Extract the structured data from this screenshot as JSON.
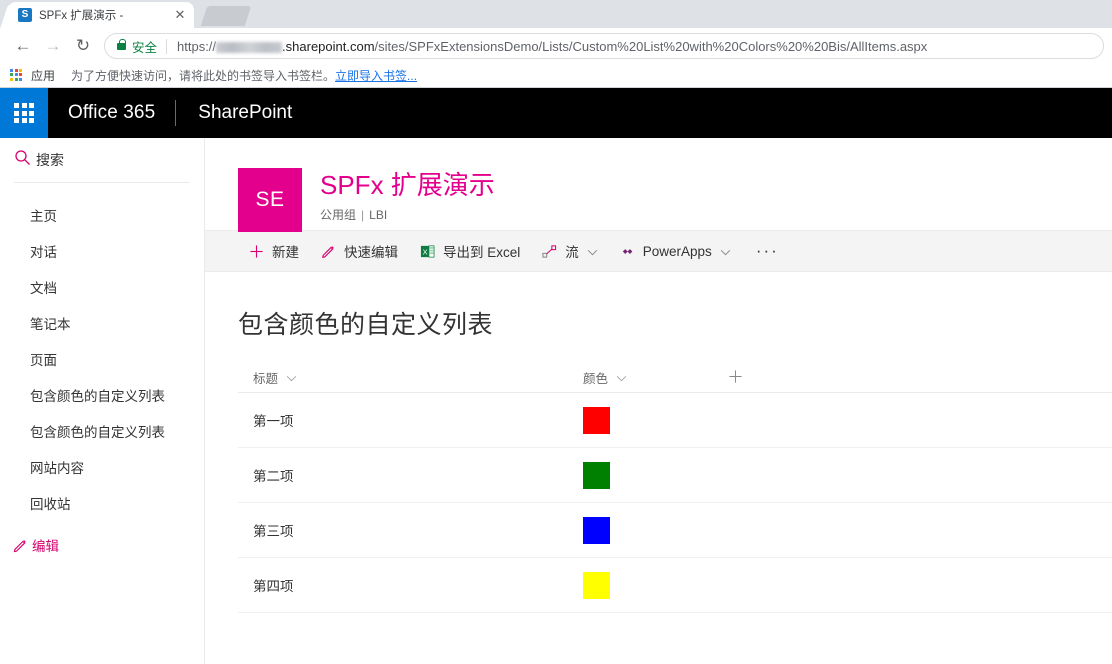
{
  "browser": {
    "tab": {
      "title": "SPFx 扩展演示 -",
      "favicon": "sharepoint-icon",
      "close_icon": "close-icon"
    },
    "new_tab_icon": "new-tab-button",
    "back_icon": "back-arrow-icon",
    "forward_icon": "forward-arrow-icon",
    "reload_icon": "reload-icon",
    "security": {
      "lock_icon": "lock-icon",
      "label": "安全"
    },
    "url": {
      "scheme": "https://",
      "tenant_blurred": "",
      "host_suffix": ".sharepoint.com",
      "path": "/sites/SPFxExtensionsDemo/Lists/Custom%20List%20with%20Colors%20%20Bis/AllItems.aspx",
      "full": "https://.sharepoint.com/sites/SPFxExtensionsDemo/Lists/Custom%20List%20with%20Colors%20%20Bis/AllItems.aspx"
    },
    "bookmarks": {
      "apps_icon": "apps-grid-icon",
      "apps_label": "应用",
      "hint": "为了方便快速访问，请将此处的书签导入书签栏。",
      "import_link": "立即导入书签..."
    }
  },
  "suitebar": {
    "waffle_icon": "waffle-icon",
    "brand": "Office 365",
    "app": "SharePoint"
  },
  "leftnav": {
    "search": {
      "icon": "search-icon",
      "label": "搜索"
    },
    "items": [
      {
        "label": "主页"
      },
      {
        "label": "对话"
      },
      {
        "label": "文档"
      },
      {
        "label": "笔记本"
      },
      {
        "label": "页面"
      },
      {
        "label": "包含颜色的自定义列表"
      },
      {
        "label": "包含颜色的自定义列表"
      },
      {
        "label": "网站内容"
      },
      {
        "label": "回收站"
      }
    ],
    "edit": {
      "icon": "pencil-icon",
      "label": "编辑",
      "color": "#d6006e"
    }
  },
  "site": {
    "logo_initials": "SE",
    "logo_color": "#e3008c",
    "title": "SPFx 扩展演示",
    "title_color": "#e3008c",
    "privacy": "公用组",
    "classification": "LBI"
  },
  "commandbar": {
    "commands": [
      {
        "icon": "plus-icon",
        "label": "新建",
        "has_chevron": false
      },
      {
        "icon": "pencil-icon",
        "label": "快速编辑",
        "has_chevron": false
      },
      {
        "icon": "excel-icon",
        "label": "导出到 Excel",
        "has_chevron": false
      },
      {
        "icon": "flow-icon",
        "label": "流",
        "has_chevron": true
      },
      {
        "icon": "powerapps-icon",
        "label": "PowerApps",
        "has_chevron": true
      }
    ],
    "overflow_label": "···"
  },
  "list": {
    "title": "包含颜色的自定义列表",
    "columns": [
      {
        "label": "标题",
        "chevron": "chevron-down-icon"
      },
      {
        "label": "颜色",
        "chevron": "chevron-down-icon"
      }
    ],
    "add_column_icon": "plus-icon",
    "rows": [
      {
        "title": "第一项",
        "color": "#ff0000"
      },
      {
        "title": "第二项",
        "color": "#008000"
      },
      {
        "title": "第三项",
        "color": "#0000ff"
      },
      {
        "title": "第四项",
        "color": "#ffff00"
      }
    ]
  }
}
